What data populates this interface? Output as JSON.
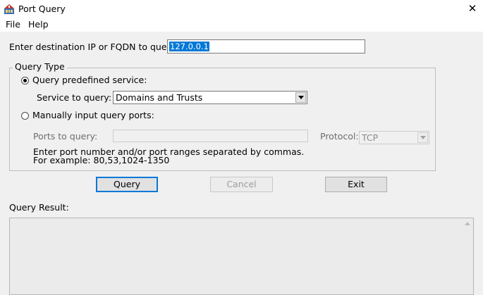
{
  "window": {
    "title": "Port Query",
    "close_symbol": "✕",
    "icon": "port-query-app-icon"
  },
  "menu": {
    "items": [
      {
        "label": "File"
      },
      {
        "label": "Help"
      }
    ]
  },
  "destination": {
    "label": "Enter destination IP or FQDN to query:",
    "value": "127.0.0.1"
  },
  "query_type": {
    "legend": "Query Type",
    "predefined": {
      "label": "Query predefined service:",
      "checked": true,
      "service_label": "Service to query:",
      "service_value": "Domains and Trusts"
    },
    "manual": {
      "label": "Manually input query ports:",
      "checked": false,
      "ports_label": "Ports to query:",
      "ports_value": "",
      "protocol_label": "Protocol:",
      "protocol_value": "TCP",
      "help_line1": "Enter port number and/or port ranges separated by commas.",
      "help_line2": "For example: 80,53,1024-1350"
    }
  },
  "buttons": {
    "query": "Query",
    "cancel": "Cancel",
    "exit": "Exit"
  },
  "results": {
    "label": "Query Result:",
    "text": ""
  },
  "colors": {
    "selection": "#0078d7",
    "default_button_border": "#0078d7"
  }
}
